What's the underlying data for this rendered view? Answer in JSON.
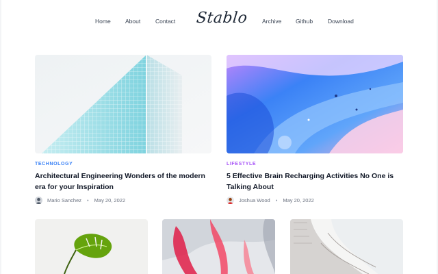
{
  "nav": {
    "left": [
      "Home",
      "About",
      "Contact"
    ],
    "logo": "Stablo",
    "right": [
      "Archive",
      "Github",
      "Download"
    ]
  },
  "posts": [
    {
      "category": "TECHNOLOGY",
      "category_color": "#3b82f6",
      "title": "Architectural Engineering Wonders of the modern era for your Inspiration",
      "author": "Mario Sanchez",
      "date": "May 20, 2022"
    },
    {
      "category": "LIFESTYLE",
      "category_color": "#a855f7",
      "title": "5 Effective Brain Recharging Activities No One is Talking About",
      "author": "Joshua Wood",
      "date": "May 20, 2022"
    }
  ]
}
